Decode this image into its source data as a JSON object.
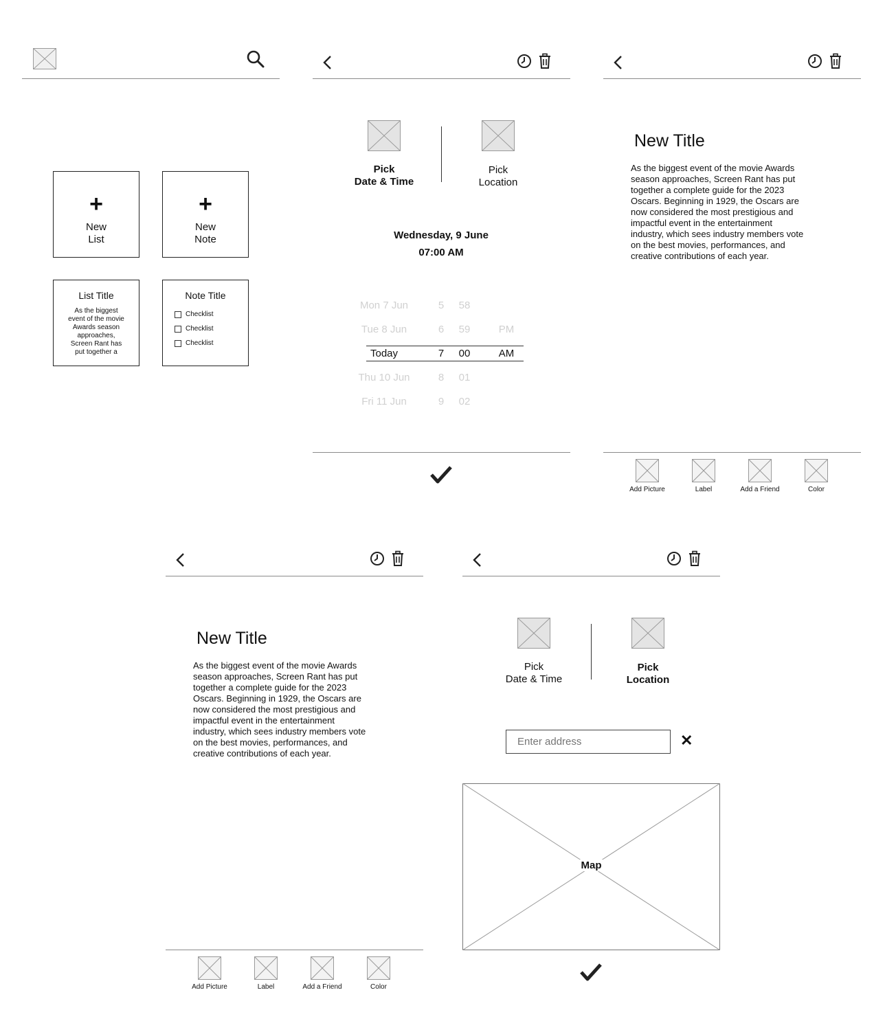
{
  "screen1": {
    "search_icon": "search-icon",
    "tiles": {
      "new_list": {
        "plus": "+",
        "line1": "New",
        "line2": "List"
      },
      "new_note": {
        "plus": "+",
        "line1": "New",
        "line2": "Note"
      }
    },
    "list_card": {
      "title": "List Title",
      "lines": [
        "As the biggest",
        "event of the movie",
        "Awards season",
        "approaches,",
        "Screen Rant has",
        "put together a"
      ]
    },
    "note_card": {
      "title": "Note Title",
      "items": [
        "Checklist",
        "Checklist",
        "Checklist"
      ]
    }
  },
  "screen2": {
    "pick_date": {
      "line1": "Pick",
      "line2": "Date & Time"
    },
    "pick_location": {
      "line1": "Pick",
      "line2": "Location"
    },
    "selected_date": "Wednesday, 9 June",
    "selected_time": "07:00 AM",
    "picker": {
      "rows": [
        {
          "day": "Mon 7 Jun",
          "hour": "5",
          "minute": "58",
          "ampm": ""
        },
        {
          "day": "Tue 8 Jun",
          "hour": "6",
          "minute": "59",
          "ampm": "PM"
        },
        {
          "day": "Today",
          "hour": "7",
          "minute": "00",
          "ampm": "AM"
        },
        {
          "day": "Thu 10 Jun",
          "hour": "8",
          "minute": "01",
          "ampm": ""
        },
        {
          "day": "Fri 11 Jun",
          "hour": "9",
          "minute": "02",
          "ampm": ""
        }
      ],
      "selected_index": 2
    }
  },
  "editor": {
    "title": "New Title",
    "body_lines": [
      "As the biggest event of the movie Awards",
      "season approaches, Screen Rant has put",
      "together a complete guide for the 2023",
      "Oscars. Beginning in 1929, the Oscars are",
      "now considered the most prestigious and",
      "impactful event in the entertainment",
      "industry, which sees industry members vote",
      "on the best movies, performances, and",
      "creative contributions of each year."
    ],
    "toolbar": [
      "Add Picture",
      "Label",
      "Add a Friend",
      "Color"
    ]
  },
  "screen5": {
    "pick_date": {
      "line1": "Pick",
      "line2": "Date & Time"
    },
    "pick_location": {
      "line1": "Pick",
      "line2": "Location"
    },
    "address_placeholder": "Enter address",
    "clear_symbol": "✕",
    "map_label": "Map"
  },
  "icons": {
    "back": "chevron-left-icon",
    "history": "clock-icon",
    "trash": "trash-icon",
    "confirm": "checkmark-icon",
    "placeholder": "image-placeholder-icon"
  }
}
